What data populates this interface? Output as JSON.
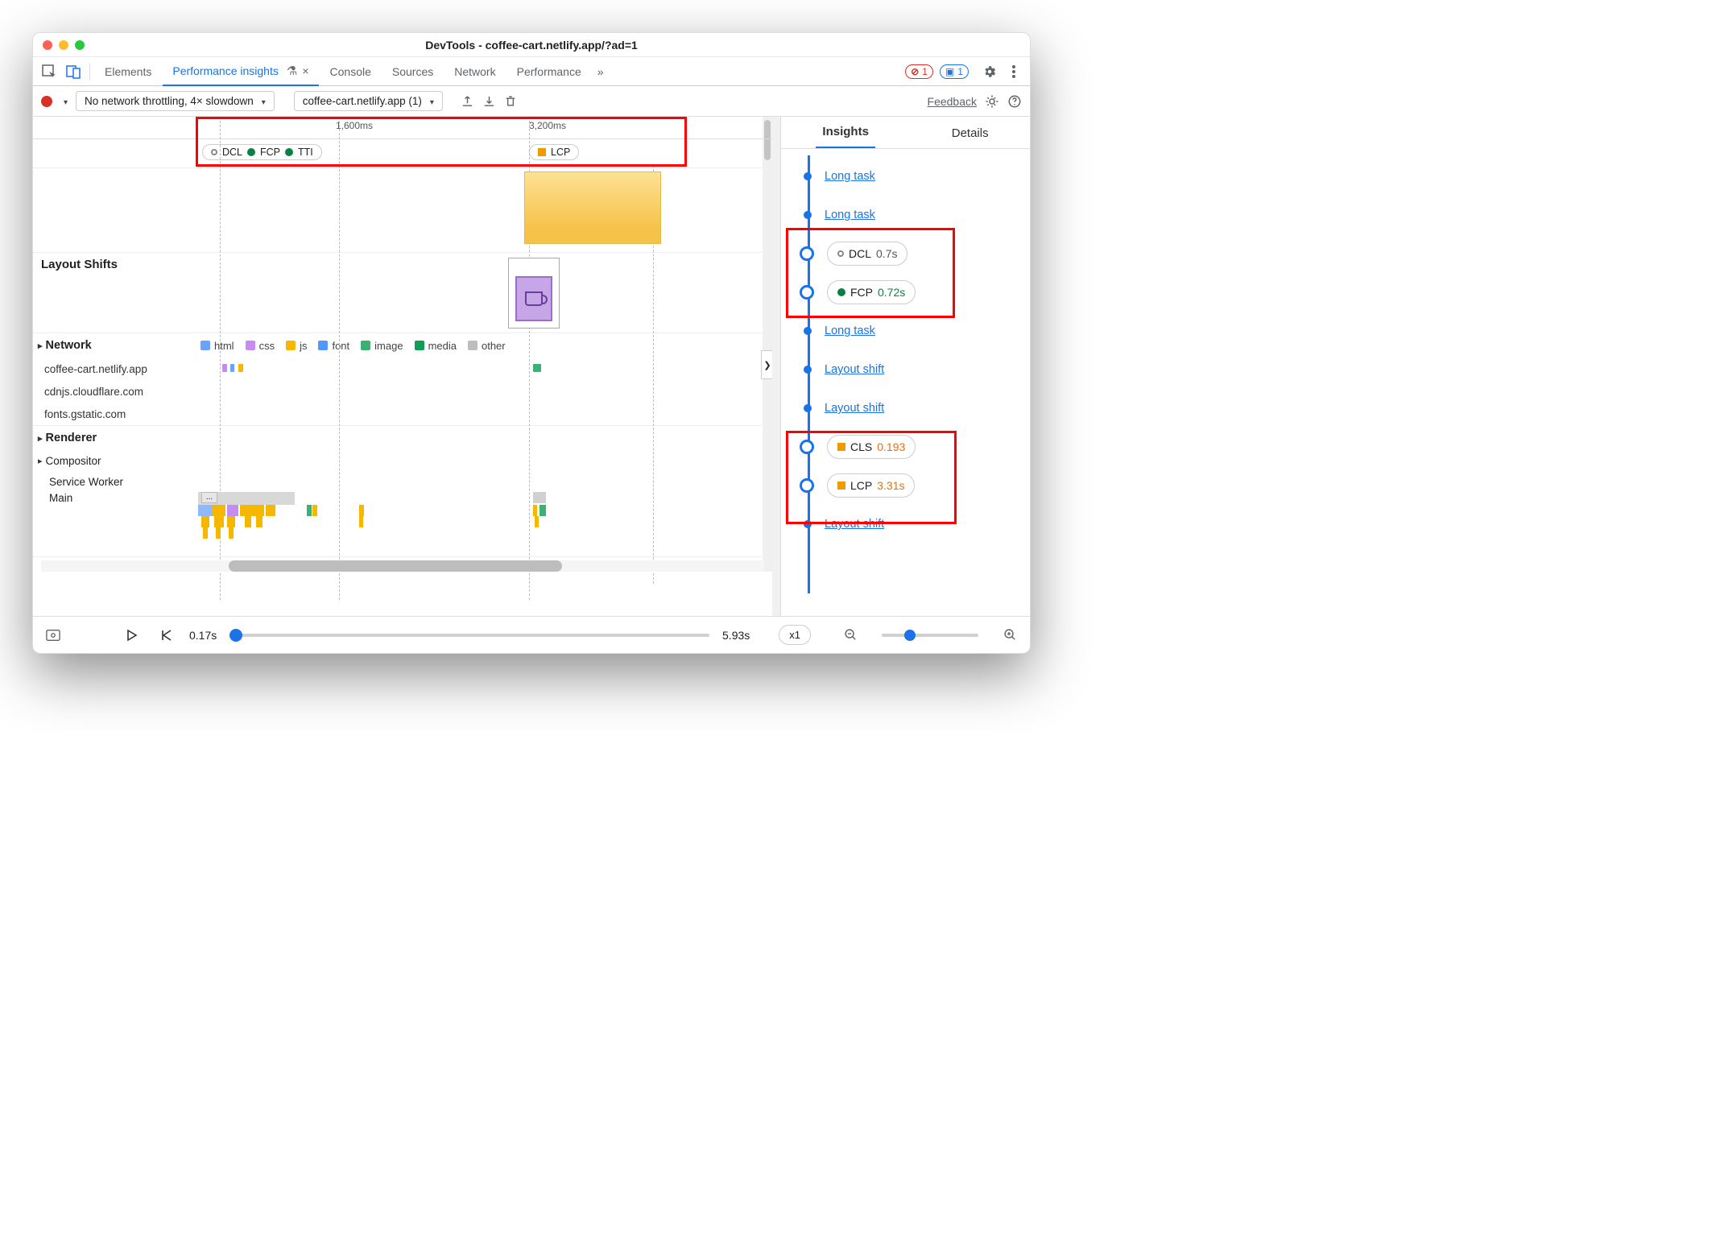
{
  "window": {
    "title": "DevTools - coffee-cart.netlify.app/?ad=1"
  },
  "tabs": {
    "items": [
      "Elements",
      "Performance insights",
      "Console",
      "Sources",
      "Network",
      "Performance"
    ],
    "activeIndex": 1,
    "closeGlyph": "×",
    "moreGlyph": "»",
    "errorCount": "1",
    "infoCount": "1"
  },
  "toolbar": {
    "throttling": "No network throttling, 4× slowdown",
    "recording": "coffee-cart.netlify.app (1)",
    "feedback": "Feedback"
  },
  "ruler": {
    "t1": "1,600ms",
    "t2": "3,200ms"
  },
  "markers": {
    "group1": {
      "dcl": "DCL",
      "fcp": "FCP",
      "tti": "TTI"
    },
    "group2": {
      "lcp": "LCP"
    }
  },
  "sections": {
    "layoutShifts": "Layout Shifts",
    "network": "Network",
    "renderer": "Renderer",
    "compositor": "Compositor",
    "serviceWorker": "Service Worker",
    "main": "Main"
  },
  "netLegend": {
    "html": "html",
    "css": "css",
    "js": "js",
    "font": "font",
    "image": "image",
    "media": "media",
    "other": "other"
  },
  "netHosts": [
    "coffee-cart.netlify.app",
    "cdnjs.cloudflare.com",
    "fonts.gstatic.com"
  ],
  "flameEllipsis": "...",
  "footer": {
    "start": "0.17s",
    "end": "5.93s",
    "speed": "x1"
  },
  "rightTabs": {
    "insights": "Insights",
    "details": "Details"
  },
  "insights": [
    {
      "kind": "link",
      "text": "Long task"
    },
    {
      "kind": "link",
      "text": "Long task"
    },
    {
      "kind": "pill",
      "marker": "hollow",
      "label": "DCL",
      "value": "0.7s",
      "valClass": "gray"
    },
    {
      "kind": "pill",
      "marker": "green",
      "label": "FCP",
      "value": "0.72s",
      "valClass": "green"
    },
    {
      "kind": "link",
      "text": "Long task"
    },
    {
      "kind": "link",
      "text": "Layout shift"
    },
    {
      "kind": "link",
      "text": "Layout shift"
    },
    {
      "kind": "pill",
      "marker": "orange-sq",
      "label": "CLS",
      "value": "0.193",
      "valClass": "orange"
    },
    {
      "kind": "pill",
      "marker": "orange-sq",
      "label": "LCP",
      "value": "3.31s",
      "valClass": "orange"
    },
    {
      "kind": "link",
      "text": "Layout shift"
    }
  ],
  "colors": {
    "html": "#6aa2ff",
    "css": "#c58cf2",
    "js": "#f5b700",
    "font": "#4f98ff",
    "image": "#3bb273",
    "media": "#0f9d58",
    "other": "#bdbdbd"
  }
}
